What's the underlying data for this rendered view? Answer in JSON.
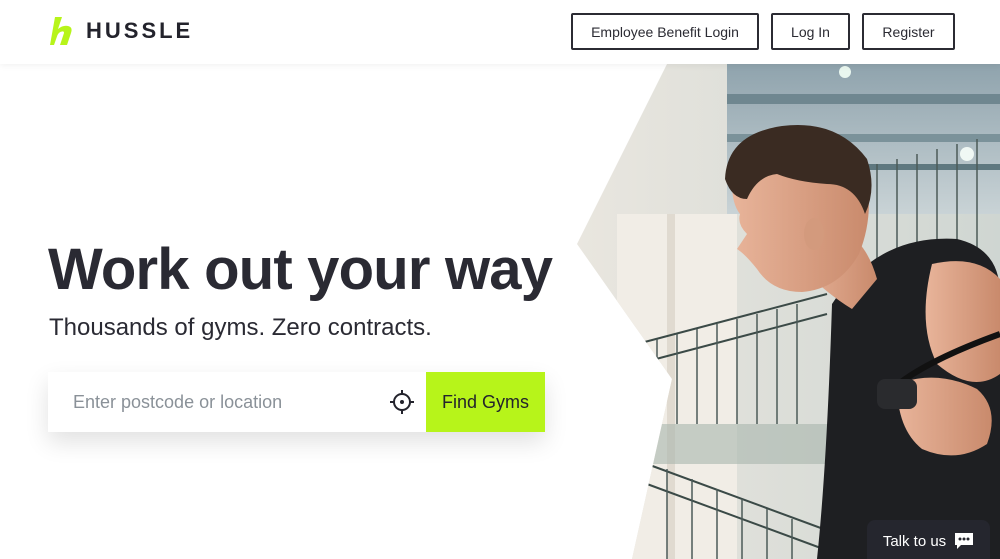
{
  "brand": {
    "name": "HUSSLE",
    "accent": "#b7f41a",
    "dark": "#2a2a33"
  },
  "nav": {
    "employee_label": "Employee Benefit Login",
    "login_label": "Log In",
    "register_label": "Register"
  },
  "hero": {
    "headline": "Work out your way",
    "subheadline": "Thousands of gyms. Zero contracts.",
    "photo_icon": "athlete-photo"
  },
  "search": {
    "placeholder": "Enter postcode or location",
    "value": "",
    "locate_icon": "crosshair-icon",
    "button_label": "Find Gyms"
  },
  "chat": {
    "label": "Talk to us",
    "icon": "chat-bubble-icon"
  }
}
